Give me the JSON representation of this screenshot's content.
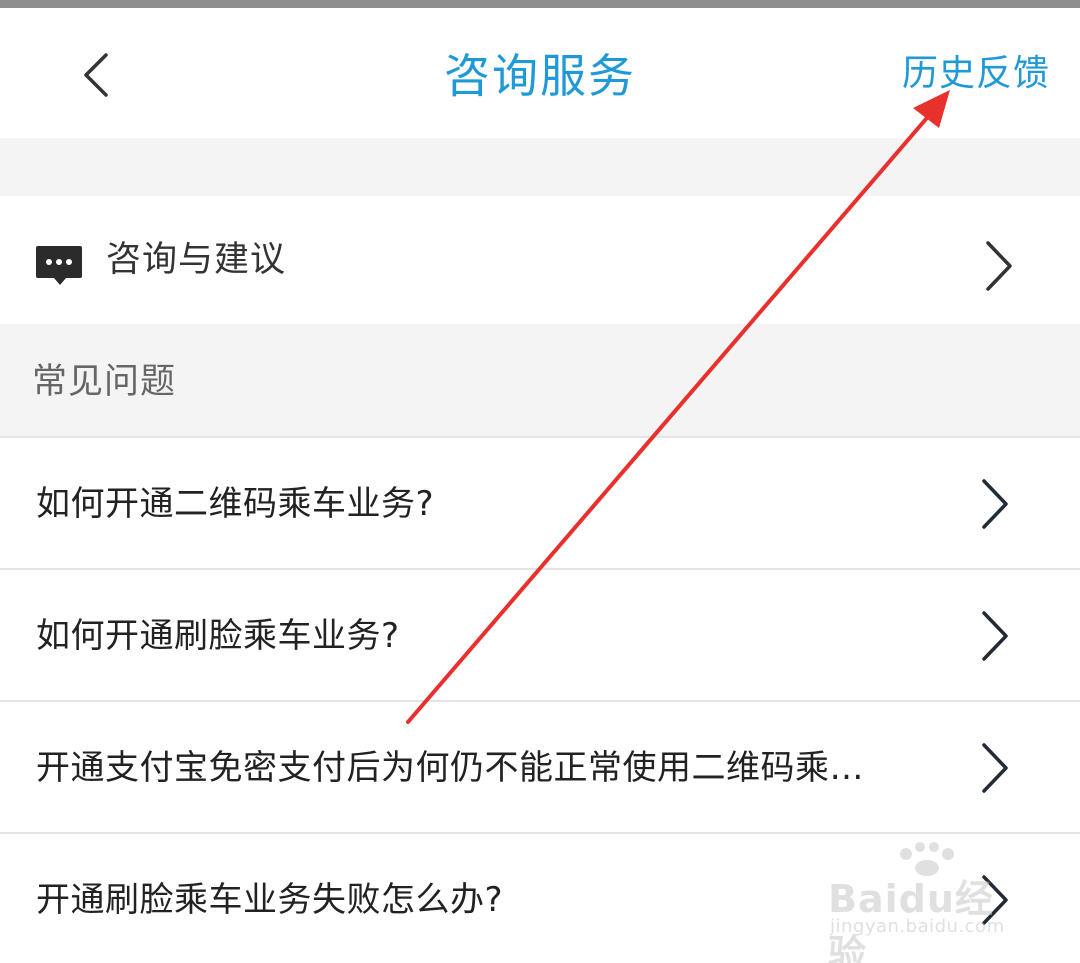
{
  "header": {
    "back_icon": "chevron-left-icon",
    "title": "咨询服务",
    "history_label": "历史反馈",
    "accent_color": "#1f9ad6"
  },
  "consult": {
    "icon": "chat-bubble-icon",
    "label": "咨询与建议"
  },
  "faq": {
    "section_title": "常见问题",
    "items": [
      {
        "label": "如何开通二维码乘车业务?"
      },
      {
        "label": "如何开通刷脸乘车业务?"
      },
      {
        "label": "开通支付宝免密支付后为何仍不能正常使用二维码乘…"
      },
      {
        "label": "开通刷脸乘车业务失败怎么办?"
      }
    ]
  },
  "annotation": {
    "arrow_color": "#e8302c"
  },
  "watermark": {
    "brand": "Baidu经验",
    "url": "jingyan.baidu.com"
  }
}
